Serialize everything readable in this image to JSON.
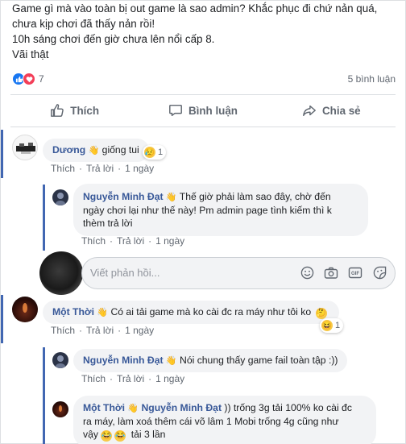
{
  "post": {
    "lines": [
      "Game gì mà vào toàn bị out game là sao admin? Khắc phục đi chứ nản quá,",
      "chưa kịp chơi đã thấy nản rồi!",
      "10h sáng chơi đến giờ chưa lên nổi cấp 8.",
      "Vãi thật"
    ],
    "reaction_count": "7",
    "comment_count": "5 bình luận"
  },
  "actions": {
    "like": "Thích",
    "comment": "Bình luận",
    "share": "Chia sẻ"
  },
  "comments": [
    {
      "name": "Dương",
      "text": "giống tui",
      "reaction_count": "1",
      "meta": {
        "like": "Thích",
        "reply": "Trả lời",
        "time": "1 ngày"
      }
    },
    {
      "name": "Nguyễn Minh Đạt",
      "text": "Thế giờ phải làm sao đây, chờ đến ngày chơi lại như thế này! Pm admin page tình kiếm thì k thèm trả lời",
      "line1": "Thế giờ phải làm sao đây, chờ đến",
      "line2": "ngày chơi lại như thế này! Pm admin page tình kiếm thì k",
      "line3": "thèm trả lời",
      "meta": {
        "like": "Thích",
        "reply": "Trả lời",
        "time": "1 ngày"
      }
    },
    {
      "name": "Một Thời",
      "text": "Có ai tải game mà ko cài đc ra máy như tôi ko",
      "reaction_count": "1",
      "meta": {
        "like": "Thích",
        "reply": "Trả lời",
        "time": "1 ngày"
      }
    },
    {
      "name": "Nguyễn Minh Đạt",
      "text": "Nói chung thấy game fail toàn tập :))",
      "meta": {
        "like": "Thích",
        "reply": "Trả lời",
        "time": "1 ngày"
      }
    },
    {
      "name": "Một Thời",
      "tag": "Nguyễn Minh Đạt",
      "line1": ")) trống 3g tải 100% ko cài đc",
      "line2": "ra máy, làm xoá thêm cái võ lâm 1 Mobi trống 4g cũng như",
      "line3_pre": "vậy",
      "line3_post": "tải 3 lần"
    }
  ],
  "reply_box": {
    "placeholder": "Viết phản hồi..."
  },
  "colors": {
    "accent": "#4267b2",
    "name": "#385898",
    "bubble": "#f2f3f5",
    "like": "#1877f2",
    "love": "#f33e58"
  }
}
